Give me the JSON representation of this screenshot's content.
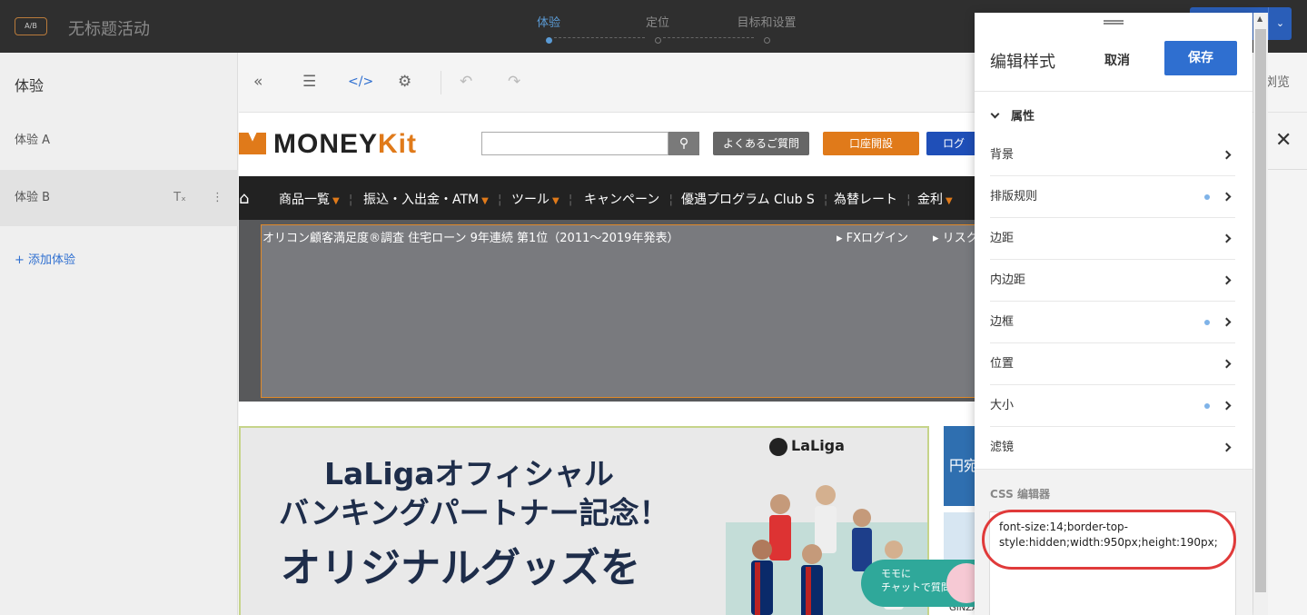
{
  "topbar": {
    "ab_badge": "A/B",
    "activity_title": "无标题活动",
    "steps": [
      {
        "label": "体验",
        "active": true
      },
      {
        "label": "定位",
        "active": false
      },
      {
        "label": "目标和设置",
        "active": false
      }
    ]
  },
  "sidebar": {
    "heading": "体验",
    "variants": [
      {
        "label": "体验 A",
        "selected": false
      },
      {
        "label": "体验 B",
        "selected": true
      }
    ],
    "add_variant": "+ 添加体验"
  },
  "toolbar": {
    "icons": [
      "collapse-icon",
      "layers-icon",
      "code-icon",
      "settings-icon",
      "undo-icon",
      "redo-icon"
    ],
    "preview_label": "浏览"
  },
  "site": {
    "logo_text_a": "MONEY",
    "logo_text_b": "Kit",
    "faq_button": "よくあるご質問",
    "open_account_button": "口座開設",
    "login_button": "ログ",
    "nav_items": [
      {
        "label": "商品一覧",
        "dropdown": true
      },
      {
        "label": "振込・入出金・ATM",
        "dropdown": true
      },
      {
        "label": "ツール",
        "dropdown": true
      },
      {
        "label": "キャンペーン",
        "dropdown": false
      },
      {
        "label": "優遇プログラム Club S",
        "dropdown": false
      },
      {
        "label": "為替レート",
        "dropdown": false
      },
      {
        "label": "金利",
        "dropdown": true
      }
    ],
    "info_text": "オリコン顧客満足度®調査 住宅ローン 9年連続 第1位（2011～2019年発表）",
    "info_links": [
      "FXログイン",
      "リスク"
    ],
    "banner_line1": "LaLigaオフィシャル",
    "banner_line2": "バンキングパートナー記念！",
    "banner_line3": "オリジナルグッズを",
    "laliga_logo": "LaLiga",
    "chat_text": "モモに\nチャットで質問",
    "side_promo_text": "円宛",
    "side_label": "GINZA"
  },
  "panel": {
    "title": "编辑样式",
    "cancel": "取消",
    "save": "保存",
    "section": "属性",
    "properties": [
      {
        "label": "背景",
        "modified": false
      },
      {
        "label": "排版规则",
        "modified": true
      },
      {
        "label": "边距",
        "modified": false
      },
      {
        "label": "内边距",
        "modified": false
      },
      {
        "label": "边框",
        "modified": true
      },
      {
        "label": "位置",
        "modified": false
      },
      {
        "label": "大小",
        "modified": true
      },
      {
        "label": "滤镜",
        "modified": false
      }
    ],
    "css_label": "CSS 编辑器",
    "css_value": "font-size:14;border-top-style:hidden;width:950px;height:190px;"
  },
  "colors": {
    "accent": "#2f6fd0",
    "brand_orange": "#e07a1a",
    "highlight_red": "#e03a3a"
  }
}
